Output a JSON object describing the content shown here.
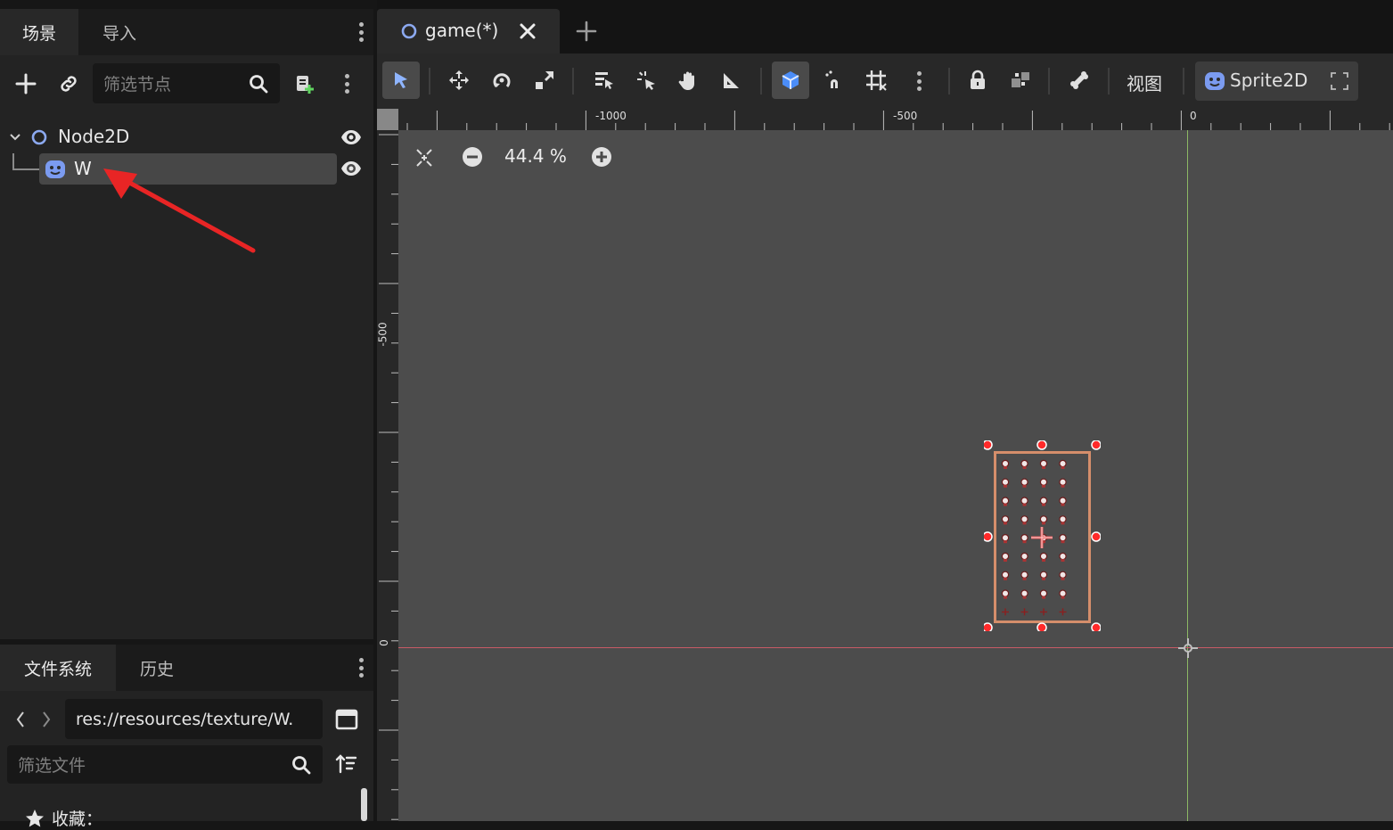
{
  "scene_dock": {
    "tabs": [
      {
        "label": "场景",
        "active": true
      },
      {
        "label": "导入",
        "active": false
      }
    ],
    "filter_placeholder": "筛选节点",
    "tree": [
      {
        "name": "Node2D",
        "type": "Node2D",
        "expanded": true,
        "visible": true
      },
      {
        "name": "W",
        "type": "Sprite2D",
        "selected": true,
        "visible": true
      }
    ]
  },
  "filesystem_dock": {
    "tabs": [
      {
        "label": "文件系统",
        "active": true
      },
      {
        "label": "历史",
        "active": false
      }
    ],
    "path": "res://resources/texture/W.",
    "filter_placeholder": "筛选文件",
    "favorites_label": "收藏："
  },
  "editor": {
    "tab": {
      "label": "game(*)"
    },
    "toolbar": {
      "view_menu": "视图",
      "context_node": "Sprite2D"
    },
    "zoom": "44.4 %",
    "rulers": {
      "h_labels": [
        "-1000",
        "-500",
        "0"
      ],
      "v_labels": [
        "-500",
        "0"
      ]
    }
  },
  "colors": {
    "accent": "#4b88f0",
    "selection_handle": "#ff2a2a",
    "sprite_rect": "#d58e6b",
    "x_axis": "#c85a66",
    "y_axis": "#8cb865",
    "annotation_arrow": "#e82525"
  }
}
